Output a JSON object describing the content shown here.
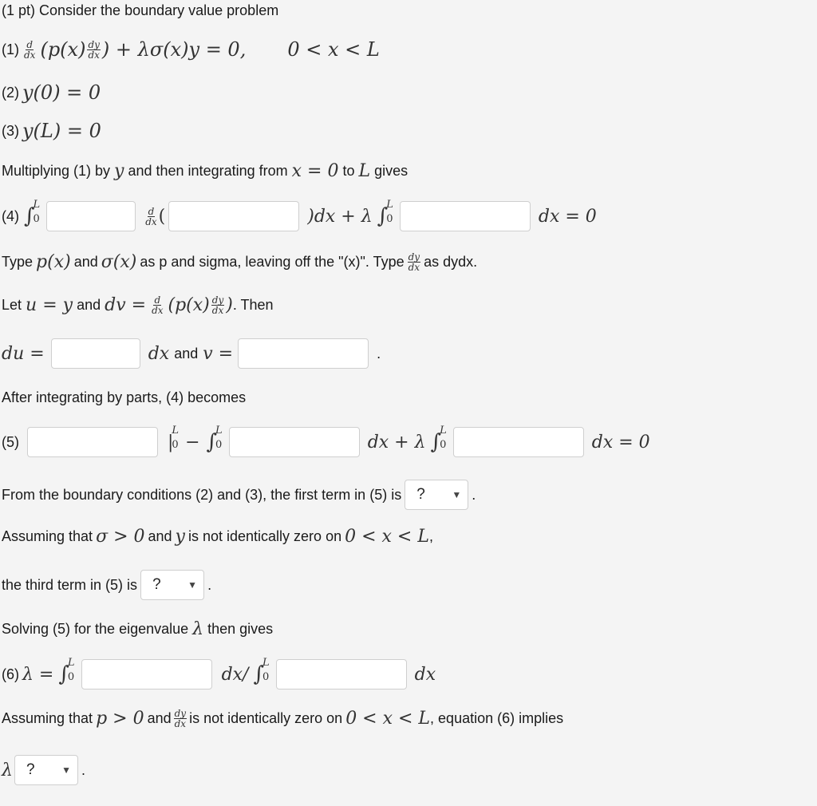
{
  "intro": "(1 pt) Consider the boundary value problem",
  "eq1": {
    "label": "(1)",
    "expr_left": "(p(x)",
    "expr_mid": ") + λσ(x)y = 0,",
    "domain": "0 < x < L"
  },
  "eq2": {
    "label": "(2)",
    "expr": "y(0) = 0"
  },
  "eq3": {
    "label": "(3)",
    "expr": "y(L) = 0"
  },
  "multiply_text": {
    "a": "Multiplying (1) by",
    "y": "y",
    "b": "and then integrating from",
    "x0": "x = 0",
    "c": "to",
    "L": "L",
    "d": "gives"
  },
  "eq4": {
    "label": "(4)",
    "open_paren": "(",
    "mid": ")dx + λ",
    "end": "dx = 0"
  },
  "type_hint": {
    "a": "Type",
    "px": "p(x)",
    "b": "and",
    "sx": "σ(x)",
    "c": "as p and sigma, leaving off the \"(x)\". Type",
    "d": "as dydx."
  },
  "let_text": {
    "a": "Let",
    "u_eq": "u = y",
    "b": "and",
    "dv_eq": "dv =",
    "px": "(p(x)",
    "close": ")",
    "c": ". Then"
  },
  "du_line": {
    "du": "du =",
    "dx": "dx",
    "and": "and",
    "v": "v =",
    "period": "."
  },
  "after_parts": "After integrating by parts, (4) becomes",
  "eq5": {
    "label": "(5)",
    "eval": "|",
    "eval_up": "L",
    "eval_lo": "0",
    "minus": "−",
    "mid": "dx + λ",
    "end": "dx = 0"
  },
  "bc_text": {
    "a": "From the boundary conditions (2) and (3), the first term in (5) is",
    "period": "."
  },
  "assume1": {
    "a": "Assuming that",
    "sigma": "σ > 0",
    "b": "and",
    "y": "y",
    "c": "is not identically zero on",
    "range": "0 < x < L",
    "comma": ","
  },
  "third_text": {
    "a": "the third term in (5) is",
    "period": "."
  },
  "solving_text": {
    "a": "Solving (5) for the eigenvalue",
    "lambda": "λ",
    "b": "then gives"
  },
  "eq6": {
    "label": "(6)",
    "lhs": "λ =",
    "mid": "dx/",
    "end": "dx"
  },
  "assume2": {
    "a": "Assuming that",
    "p": "p > 0",
    "b": "and",
    "c": "is not identically zero on",
    "range": "0 < x < L",
    "d": ", equation (6) implies"
  },
  "final": {
    "lambda": "λ",
    "period": "."
  },
  "fractions": {
    "d": "d",
    "dx": "dx",
    "dy": "dy"
  },
  "integral": {
    "sym": "∫",
    "upper": "L",
    "lower": "0"
  },
  "dropdowns": {
    "first_term": {
      "selected": "?",
      "arrow": "▼"
    },
    "third_term": {
      "selected": "?",
      "arrow": "▼"
    },
    "lambda_rel": {
      "selected": "?",
      "arrow": "▼"
    }
  },
  "inputs": {
    "eq4_a": "",
    "eq4_b": "",
    "eq4_c": "",
    "du": "",
    "v": "",
    "eq5_a": "",
    "eq5_b": "",
    "eq5_c": "",
    "eq6_a": "",
    "eq6_b": ""
  }
}
